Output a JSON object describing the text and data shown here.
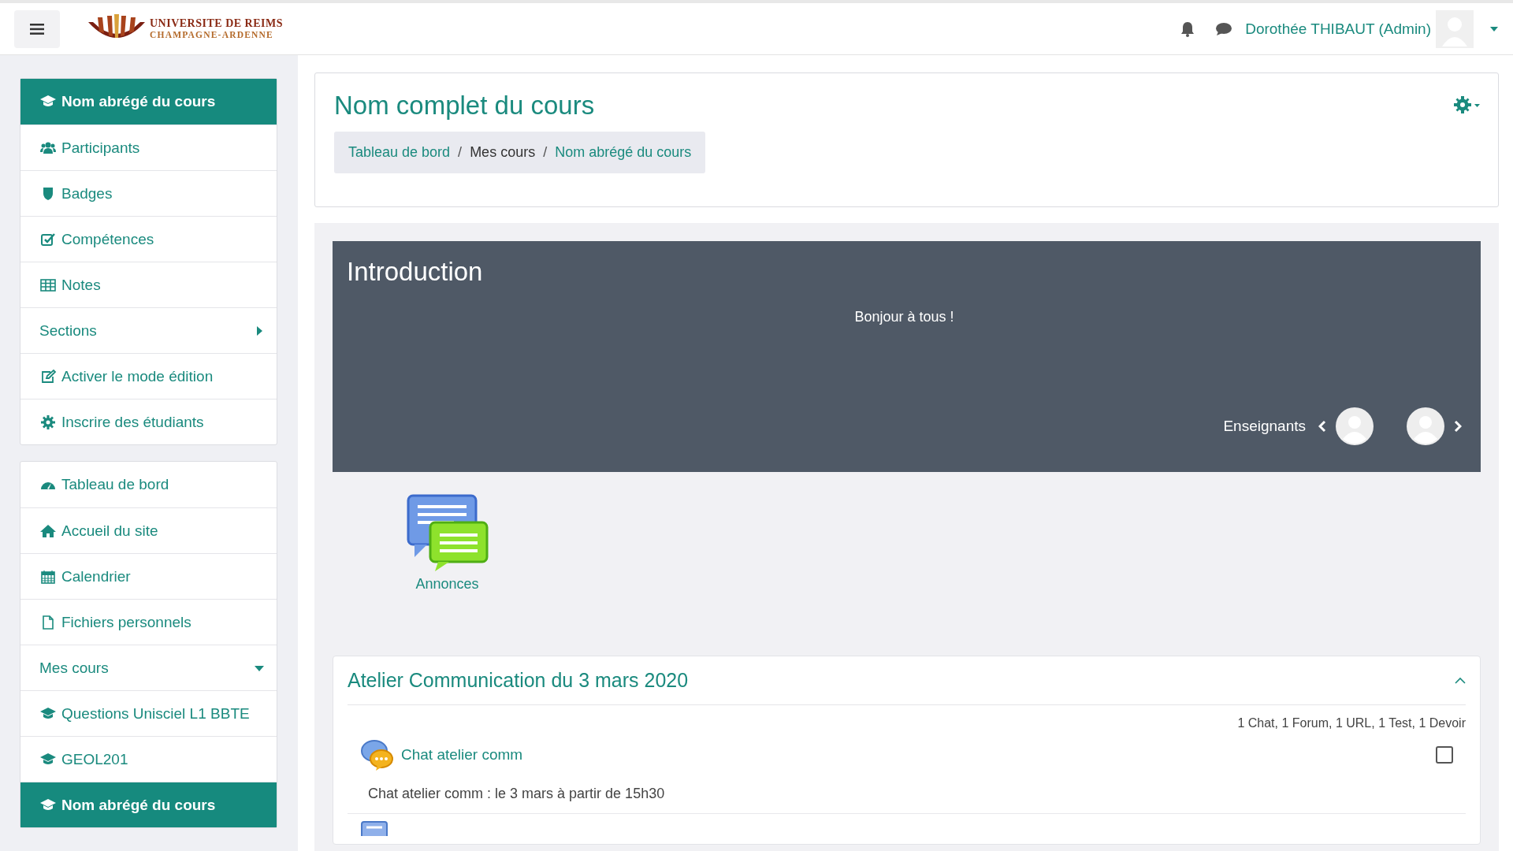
{
  "navbar": {
    "logo_line_1": "UNIVERSITE DE REIMS",
    "logo_line_2": "CHAMPAGNE-ARDENNE",
    "user_name": "Dorothée THIBAUT (Admin)"
  },
  "sidebar": {
    "blocks": [
      {
        "items": [
          {
            "label": "Nom abrégé du cours",
            "kind": "header",
            "selected": true
          },
          {
            "label": "Participants",
            "kind": "link",
            "selected": false
          },
          {
            "label": "Badges",
            "kind": "link",
            "selected": false
          },
          {
            "label": "Compétences",
            "kind": "link",
            "selected": false
          },
          {
            "label": "Notes",
            "kind": "link",
            "selected": false
          },
          {
            "label": "Sections",
            "kind": "toggle",
            "selected": false,
            "expanded": false
          },
          {
            "label": "Activer le mode édition",
            "kind": "link",
            "selected": false
          },
          {
            "label": "Inscrire des étudiants",
            "kind": "link",
            "selected": false
          }
        ]
      },
      {
        "items": [
          {
            "label": "Tableau de bord",
            "kind": "link",
            "selected": false
          },
          {
            "label": "Accueil du site",
            "kind": "link",
            "selected": false
          },
          {
            "label": "Calendrier",
            "kind": "link",
            "selected": false
          },
          {
            "label": "Fichiers personnels",
            "kind": "link",
            "selected": false
          },
          {
            "label": "Mes cours",
            "kind": "toggle",
            "selected": false,
            "expanded": true
          },
          {
            "label": "Questions Unisciel L1 BBTE",
            "kind": "link",
            "selected": false
          },
          {
            "label": "GEOL201",
            "kind": "link",
            "selected": false
          },
          {
            "label": "Nom abrégé du cours",
            "kind": "header",
            "selected": true
          }
        ]
      }
    ]
  },
  "page_header": {
    "title": "Nom complet du cours",
    "separator": "/",
    "breadcrumb": [
      {
        "label": "Tableau de bord",
        "kind": "link"
      },
      {
        "label": "Mes cours",
        "kind": "text"
      },
      {
        "label": "Nom abrégé du cours",
        "kind": "link"
      }
    ]
  },
  "intro": {
    "title": "Introduction",
    "message": "Bonjour à tous !",
    "teachers_label": "Enseignants"
  },
  "announcements": {
    "label": "Annonces"
  },
  "section": {
    "title": "Atelier Communication du 3 mars 2020",
    "expanded": true,
    "summary": "1 Chat, 1 Forum, 1 URL, 1 Test, 1 Devoir",
    "activities": [
      {
        "name": "Chat atelier comm",
        "description": "Chat atelier comm : le 3 mars à partir de 15h30",
        "checked": false
      }
    ]
  }
}
